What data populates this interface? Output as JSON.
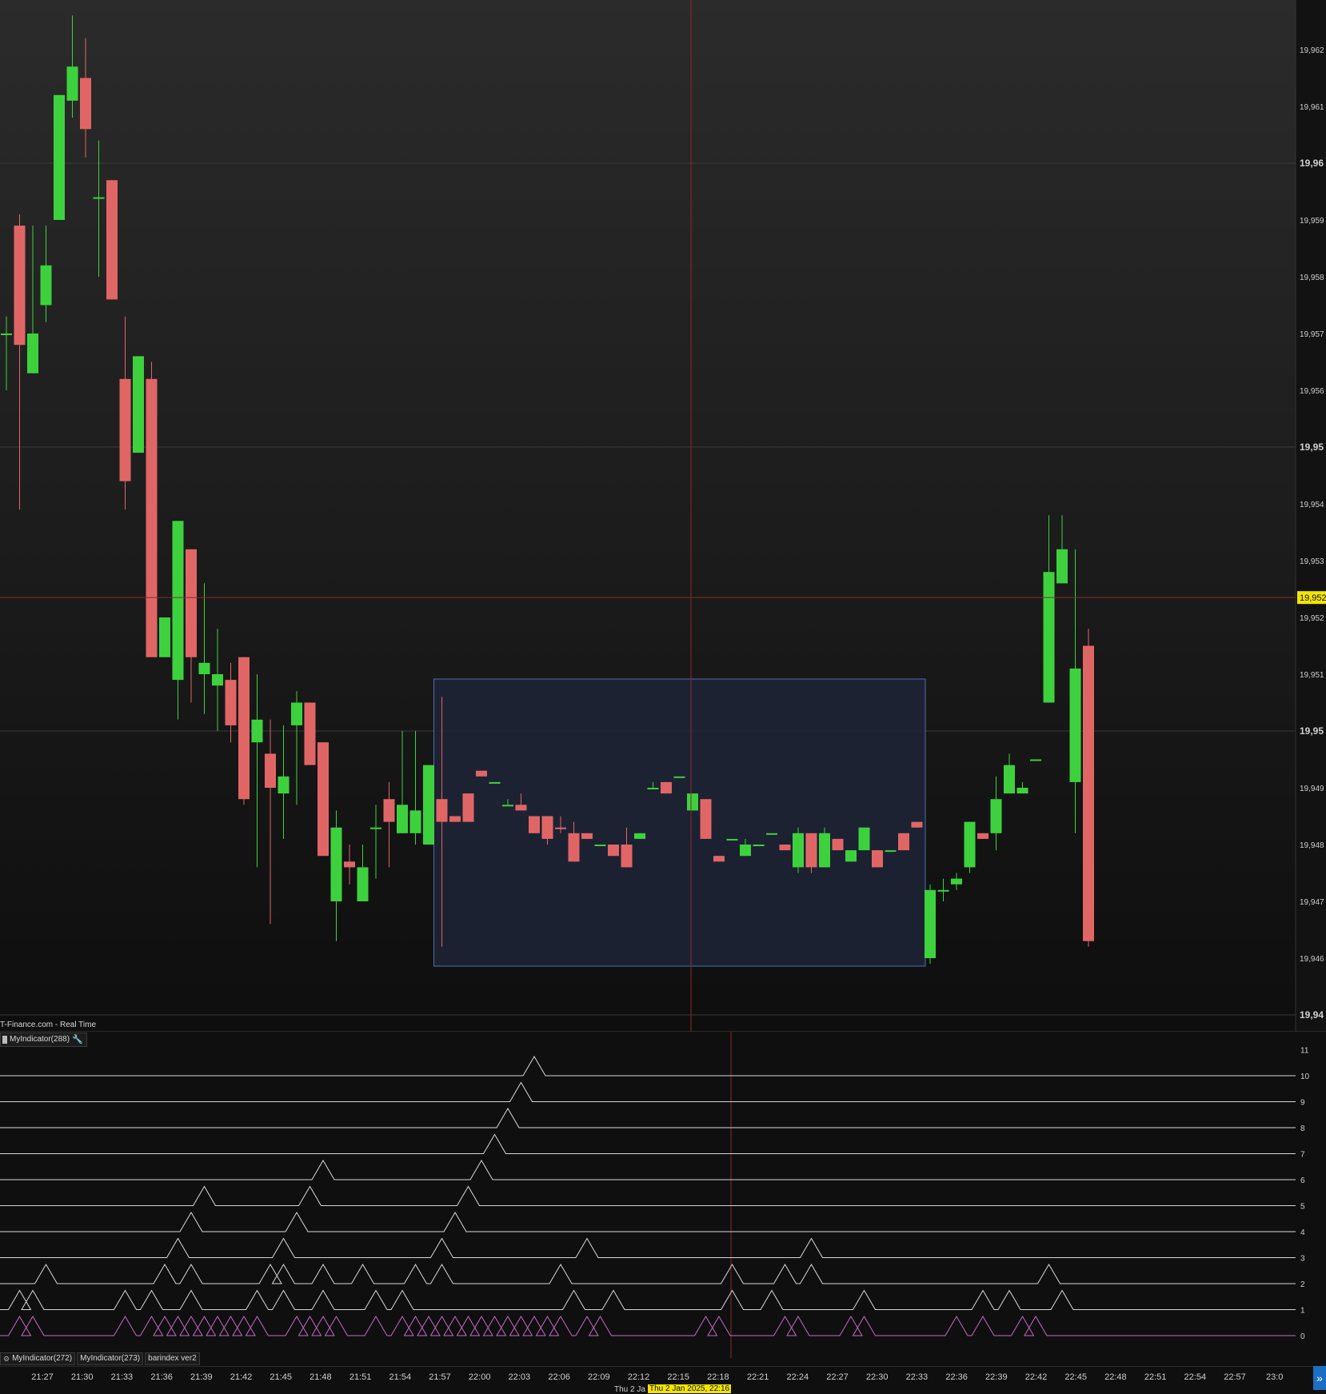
{
  "source_label": "T-Finance.com - Real Time",
  "indicator_tab": {
    "label": "MyIndicator(288)",
    "wrench_icon": "wrench-icon"
  },
  "bottom_tabs": [
    {
      "label": "MyIndicator(272)"
    },
    {
      "label": "MyIndicator(273)"
    },
    {
      "label": "barindex ver2"
    }
  ],
  "price_axis": {
    "labels": [
      {
        "value": 19962,
        "text": "19,962",
        "major": false
      },
      {
        "value": 19961,
        "text": "19,961",
        "major": false
      },
      {
        "value": 19960,
        "text": "19,96",
        "major": true
      },
      {
        "value": 19959,
        "text": "19,959",
        "major": false
      },
      {
        "value": 19958,
        "text": "19,958",
        "major": false
      },
      {
        "value": 19957,
        "text": "19,957",
        "major": false
      },
      {
        "value": 19956,
        "text": "19,956",
        "major": false
      },
      {
        "value": 19955,
        "text": "19,95",
        "major": true
      },
      {
        "value": 19954,
        "text": "19,954",
        "major": false
      },
      {
        "value": 19953,
        "text": "19,953",
        "major": false
      },
      {
        "value": 19952,
        "text": "19,952",
        "major": false
      },
      {
        "value": 19951,
        "text": "19,951",
        "major": false
      },
      {
        "value": 19950,
        "text": "19,95",
        "major": true
      },
      {
        "value": 19949,
        "text": "19,949",
        "major": false
      },
      {
        "value": 19948,
        "text": "19,948",
        "major": false
      },
      {
        "value": 19947,
        "text": "19,947",
        "major": false
      },
      {
        "value": 19946,
        "text": "19,946",
        "major": false
      },
      {
        "value": 19945,
        "text": "19,94",
        "major": true
      }
    ],
    "crosshair_price": "19,952",
    "crosshair_value": 19952.35
  },
  "indicator_axis": {
    "levels": [
      "11",
      "10",
      "9",
      "8",
      "7",
      "6",
      "5",
      "4",
      "3",
      "2",
      "1",
      "0"
    ]
  },
  "time_axis": {
    "labels": [
      "21:27",
      "21:30",
      "21:33",
      "21:36",
      "21:39",
      "21:42",
      "21:45",
      "21:48",
      "21:51",
      "21:54",
      "21:57",
      "22:00",
      "22:03",
      "22:06",
      "22:09",
      "22:12",
      "22:15",
      "22:18",
      "22:21",
      "22:24",
      "22:27",
      "22:30",
      "22:33",
      "22:36",
      "22:39",
      "22:42",
      "22:45",
      "22:48",
      "22:51",
      "22:54",
      "22:57",
      "23:0"
    ],
    "date_left": "Thu 2 Ja",
    "date_highlight": "Thu 2 Jan 2025, 22:16"
  },
  "colors": {
    "up": "#3ed13e",
    "down": "#e06666",
    "box_fill": "#1e2538",
    "box_stroke": "#4a6fb0",
    "crosshair": "#8a2a2a",
    "indicator_line": "#d8d8d8",
    "indicator_line0": "#c46bc4",
    "price_label_bg": "#f2e500"
  },
  "chart_data": {
    "type": "candlestick",
    "title": "",
    "xlabel": "",
    "ylabel": "",
    "ylim": [
      19945,
      19963
    ],
    "candles": [
      {
        "t": 0,
        "o": 19957,
        "h": 19957.3,
        "l": 19956,
        "c": 19957,
        "d": "up"
      },
      {
        "t": 1,
        "o": 19958.9,
        "h": 19959.1,
        "l": 19953.9,
        "c": 19956.8,
        "d": "down"
      },
      {
        "t": 2,
        "o": 19956.3,
        "h": 19958.9,
        "l": 19956.3,
        "c": 19957,
        "d": "up"
      },
      {
        "t": 3,
        "o": 19957.5,
        "h": 19958.9,
        "l": 19957.2,
        "c": 19958.2,
        "d": "up"
      },
      {
        "t": 4,
        "o": 19959,
        "h": 19961,
        "l": 19959,
        "c": 19961.2,
        "d": "up"
      },
      {
        "t": 5,
        "o": 19961.1,
        "h": 19962.6,
        "l": 19960.8,
        "c": 19961.7,
        "d": "up"
      },
      {
        "t": 6,
        "o": 19961.5,
        "h": 19962.2,
        "l": 19960.1,
        "c": 19960.6,
        "d": "down"
      },
      {
        "t": 7,
        "o": 19959.4,
        "h": 19960.4,
        "l": 19958,
        "c": 19959.4,
        "d": "up"
      },
      {
        "t": 8,
        "o": 19959.7,
        "h": 19959.7,
        "l": 19957.6,
        "c": 19957.6,
        "d": "down"
      },
      {
        "t": 9,
        "o": 19956.2,
        "h": 19957.3,
        "l": 19953.9,
        "c": 19954.4,
        "d": "down"
      },
      {
        "t": 10,
        "o": 19954.9,
        "h": 19956.4,
        "l": 19954.9,
        "c": 19956.6,
        "d": "up"
      },
      {
        "t": 11,
        "o": 19956.2,
        "h": 19956.5,
        "l": 19952.2,
        "c": 19951.3,
        "d": "down"
      },
      {
        "t": 12,
        "o": 19951.3,
        "h": 19951.3,
        "l": 19952,
        "c": 19952,
        "d": "up"
      },
      {
        "t": 13,
        "o": 19950.9,
        "h": 19952.9,
        "l": 19950.2,
        "c": 19953.7,
        "d": "up"
      },
      {
        "t": 14,
        "o": 19953.2,
        "h": 19953.2,
        "l": 19950.5,
        "c": 19951.3,
        "d": "down"
      },
      {
        "t": 15,
        "o": 19951.0,
        "h": 19952.6,
        "l": 19950.3,
        "c": 19951.2,
        "d": "up"
      },
      {
        "t": 16,
        "o": 19951,
        "h": 19951.8,
        "l": 19950,
        "c": 19950.8,
        "d": "up"
      },
      {
        "t": 17,
        "o": 19950.9,
        "h": 19951.2,
        "l": 19949.8,
        "c": 19950.1,
        "d": "down"
      },
      {
        "t": 18,
        "o": 19951.3,
        "h": 19951.3,
        "l": 19948.7,
        "c": 19948.8,
        "d": "down"
      },
      {
        "t": 19,
        "o": 19950.2,
        "h": 19951,
        "l": 19947.6,
        "c": 19949.8,
        "d": "up"
      },
      {
        "t": 20,
        "o": 19949.6,
        "h": 19950.2,
        "l": 19946.6,
        "c": 19949.0,
        "d": "down"
      },
      {
        "t": 21,
        "o": 19948.9,
        "h": 19950.1,
        "l": 19948.1,
        "c": 19949.2,
        "d": "up"
      },
      {
        "t": 22,
        "o": 19950.1,
        "h": 19950.7,
        "l": 19948.7,
        "c": 19950.5,
        "d": "up"
      },
      {
        "t": 23,
        "o": 19950.5,
        "h": 19950.5,
        "l": 19949.5,
        "c": 19949.4,
        "d": "down"
      },
      {
        "t": 24,
        "o": 19949.8,
        "h": 19949.8,
        "l": 19948.1,
        "c": 19947.8,
        "d": "down"
      },
      {
        "t": 25,
        "o": 19947.0,
        "h": 19948.6,
        "l": 19946.3,
        "c": 19948.3,
        "d": "up"
      },
      {
        "t": 26,
        "o": 19947.7,
        "h": 19948,
        "l": 19947.3,
        "c": 19947.6,
        "d": "down"
      },
      {
        "t": 27,
        "o": 19947.0,
        "h": 19948,
        "l": 19947,
        "c": 19947.6,
        "d": "up"
      },
      {
        "t": 28,
        "o": 19948.3,
        "h": 19948.7,
        "l": 19947.4,
        "c": 19948.3,
        "d": "up"
      },
      {
        "t": 29,
        "o": 19948.8,
        "h": 19949.1,
        "l": 19947.6,
        "c": 19948.4,
        "d": "down"
      },
      {
        "t": 30,
        "o": 19948.2,
        "h": 19950,
        "l": 19948.2,
        "c": 19948.7,
        "d": "up"
      },
      {
        "t": 31,
        "o": 19948.2,
        "h": 19950,
        "l": 19948.0,
        "c": 19948.6,
        "d": "up"
      },
      {
        "t": 32,
        "o": 19948,
        "h": 19949.3,
        "l": 19948,
        "c": 19949.4,
        "d": "up"
      },
      {
        "t": 33,
        "o": 19948.8,
        "h": 19950.6,
        "l": 19946.2,
        "c": 19948.4,
        "d": "down"
      },
      {
        "t": 34,
        "o": 19948.5,
        "h": 19948.5,
        "l": 19948.4,
        "c": 19948.4,
        "d": "down"
      },
      {
        "t": 35,
        "o": 19948.9,
        "h": 19948.9,
        "l": 19948.4,
        "c": 19948.4,
        "d": "down"
      },
      {
        "t": 36,
        "o": 19949.3,
        "h": 19949.3,
        "l": 19949.2,
        "c": 19949.2,
        "d": "down"
      },
      {
        "t": 37,
        "o": 19949.1,
        "h": 19949.1,
        "l": 19949.1,
        "c": 19949.1,
        "d": "up"
      },
      {
        "t": 38,
        "o": 19948.7,
        "h": 19948.8,
        "l": 19948.7,
        "c": 19948.7,
        "d": "up"
      },
      {
        "t": 39,
        "o": 19948.7,
        "h": 19948.9,
        "l": 19948.6,
        "c": 19948.6,
        "d": "down"
      },
      {
        "t": 40,
        "o": 19948.5,
        "h": 19948.5,
        "l": 19948.2,
        "c": 19948.2,
        "d": "down"
      },
      {
        "t": 41,
        "o": 19948.5,
        "h": 19948.5,
        "l": 19948.0,
        "c": 19948.1,
        "d": "down"
      },
      {
        "t": 42,
        "o": 19948.3,
        "h": 19948.5,
        "l": 19948.2,
        "c": 19948.3,
        "d": "down"
      },
      {
        "t": 43,
        "o": 19948.2,
        "h": 19948.4,
        "l": 19947.7,
        "c": 19947.7,
        "d": "down"
      },
      {
        "t": 44,
        "o": 19948.2,
        "h": 19948.2,
        "l": 19948.1,
        "c": 19948.1,
        "d": "down"
      },
      {
        "t": 45,
        "o": 19948.0,
        "h": 19948.0,
        "l": 19948.0,
        "c": 19948.0,
        "d": "up"
      },
      {
        "t": 46,
        "o": 19948.0,
        "h": 19948.0,
        "l": 19947.8,
        "c": 19947.8,
        "d": "down"
      },
      {
        "t": 47,
        "o": 19948.0,
        "h": 19948.3,
        "l": 19947.6,
        "c": 19947.6,
        "d": "down"
      },
      {
        "t": 48,
        "o": 19948.1,
        "h": 19948.2,
        "l": 19948.1,
        "c": 19948.2,
        "d": "up"
      },
      {
        "t": 49,
        "o": 19949.0,
        "h": 19949.1,
        "l": 19949.0,
        "c": 19949.0,
        "d": "up"
      },
      {
        "t": 50,
        "o": 19949.1,
        "h": 19949.1,
        "l": 19948.9,
        "c": 19948.9,
        "d": "down"
      },
      {
        "t": 51,
        "o": 19949.2,
        "h": 19949.2,
        "l": 19949.2,
        "c": 19949.2,
        "d": "up"
      },
      {
        "t": 52,
        "o": 19948.6,
        "h": 19948.9,
        "l": 19948.6,
        "c": 19948.9,
        "d": "up"
      },
      {
        "t": 53,
        "o": 19948.8,
        "h": 19948.8,
        "l": 19948.1,
        "c": 19948.1,
        "d": "down"
      },
      {
        "t": 54,
        "o": 19947.8,
        "h": 19947.8,
        "l": 19947.7,
        "c": 19947.7,
        "d": "down"
      },
      {
        "t": 55,
        "o": 19948.1,
        "h": 19948.1,
        "l": 19948.1,
        "c": 19948.1,
        "d": "up"
      },
      {
        "t": 56,
        "o": 19947.8,
        "h": 19948.1,
        "l": 19947.8,
        "c": 19948.0,
        "d": "up"
      },
      {
        "t": 57,
        "o": 19948.0,
        "h": 19948.0,
        "l": 19948.0,
        "c": 19948.0,
        "d": "up"
      },
      {
        "t": 58,
        "o": 19948.2,
        "h": 19948.2,
        "l": 19948.2,
        "c": 19948.2,
        "d": "up"
      },
      {
        "t": 59,
        "o": 19947.9,
        "h": 19948.0,
        "l": 19947.9,
        "c": 19948.0,
        "d": "down"
      },
      {
        "t": 60,
        "o": 19947.6,
        "h": 19948.3,
        "l": 19947.5,
        "c": 19948.2,
        "d": "up"
      },
      {
        "t": 61,
        "o": 19948.2,
        "h": 19948.2,
        "l": 19947.5,
        "c": 19947.6,
        "d": "down"
      },
      {
        "t": 62,
        "o": 19947.6,
        "h": 19948.3,
        "l": 19947.6,
        "c": 19948.2,
        "d": "up"
      },
      {
        "t": 63,
        "o": 19948.1,
        "h": 19948.1,
        "l": 19947.9,
        "c": 19947.9,
        "d": "down"
      },
      {
        "t": 64,
        "o": 19947.7,
        "h": 19947.9,
        "l": 19947.7,
        "c": 19947.9,
        "d": "up"
      },
      {
        "t": 65,
        "o": 19947.9,
        "h": 19948.3,
        "l": 19947.9,
        "c": 19948.3,
        "d": "up"
      },
      {
        "t": 66,
        "o": 19947.9,
        "h": 19947.9,
        "l": 19947.6,
        "c": 19947.6,
        "d": "down"
      },
      {
        "t": 67,
        "o": 19947.9,
        "h": 19947.9,
        "l": 19947.9,
        "c": 19947.9,
        "d": "up"
      },
      {
        "t": 68,
        "o": 19948.2,
        "h": 19948.2,
        "l": 19947.9,
        "c": 19947.9,
        "d": "down"
      },
      {
        "t": 69,
        "o": 19948.4,
        "h": 19948.4,
        "l": 19948.3,
        "c": 19948.3,
        "d": "down"
      },
      {
        "t": 70,
        "o": 19946,
        "h": 19947.3,
        "l": 19945.9,
        "c": 19947.2,
        "d": "up"
      },
      {
        "t": 71,
        "o": 19947.2,
        "h": 19947.4,
        "l": 19947.0,
        "c": 19947.2,
        "d": "up"
      },
      {
        "t": 72,
        "o": 19947.3,
        "h": 19947.5,
        "l": 19947.2,
        "c": 19947.4,
        "d": "up"
      },
      {
        "t": 73,
        "o": 19947.6,
        "h": 19948.4,
        "l": 19947.5,
        "c": 19948.4,
        "d": "up"
      },
      {
        "t": 74,
        "o": 19948.2,
        "h": 19948.2,
        "l": 19948.1,
        "c": 19948.1,
        "d": "down"
      },
      {
        "t": 75,
        "o": 19948.2,
        "h": 19949.2,
        "l": 19947.9,
        "c": 19948.8,
        "d": "up"
      },
      {
        "t": 76,
        "o": 19948.9,
        "h": 19949.6,
        "l": 19948.9,
        "c": 19949.4,
        "d": "up"
      },
      {
        "t": 77,
        "o": 19948.9,
        "h": 19949.1,
        "l": 19948.9,
        "c": 19949.0,
        "d": "up"
      },
      {
        "t": 78,
        "o": 19949.5,
        "h": 19949.5,
        "l": 19949.5,
        "c": 19949.5,
        "d": "up"
      },
      {
        "t": 79,
        "o": 19950.5,
        "h": 19953.8,
        "l": 19950.5,
        "c": 19952.8,
        "d": "up"
      },
      {
        "t": 80,
        "o": 19952.6,
        "h": 19953.8,
        "l": 19952.6,
        "c": 19953.2,
        "d": "up"
      },
      {
        "t": 81,
        "o": 19949.1,
        "h": 19953.2,
        "l": 19948.2,
        "c": 19951.1,
        "d": "up"
      },
      {
        "t": 82,
        "o": 19951.5,
        "h": 19951.8,
        "l": 19946.2,
        "c": 19946.3,
        "d": "down"
      }
    ],
    "highlight_box": {
      "t_start": 33,
      "t_end": 70,
      "price_top": 19951.0,
      "price_bottom": 19946.0
    },
    "indicator_series": [
      {
        "level": 0,
        "peaks": [
          1,
          2,
          9,
          11,
          12,
          13,
          14,
          15,
          16,
          17,
          18,
          19,
          22,
          23,
          24,
          25,
          28,
          30,
          31,
          32,
          33,
          34,
          35,
          36,
          37,
          38,
          39,
          40,
          41,
          42,
          44,
          45,
          53,
          54,
          59,
          60,
          64,
          65,
          72,
          74,
          77,
          78
        ]
      },
      {
        "level": 1,
        "peaks": [
          1,
          2,
          9,
          11,
          14,
          19,
          21,
          24,
          28,
          30,
          43,
          46,
          55,
          58,
          65,
          74,
          76,
          80
        ]
      },
      {
        "level": 2,
        "peaks": [
          3,
          12,
          14,
          20,
          21,
          24,
          27,
          31,
          33,
          42,
          55,
          59,
          61,
          79
        ]
      },
      {
        "level": 3,
        "peaks": [
          13,
          21,
          33,
          44,
          61
        ]
      },
      {
        "level": 4,
        "peaks": [
          14,
          22,
          34
        ]
      },
      {
        "level": 5,
        "peaks": [
          15,
          23,
          35
        ]
      },
      {
        "level": 6,
        "peaks": [
          24,
          36
        ]
      },
      {
        "level": 7,
        "peaks": [
          37
        ]
      },
      {
        "level": 8,
        "peaks": [
          38
        ]
      },
      {
        "level": 9,
        "peaks": [
          39
        ]
      },
      {
        "level": 10,
        "peaks": [
          40
        ]
      }
    ]
  }
}
